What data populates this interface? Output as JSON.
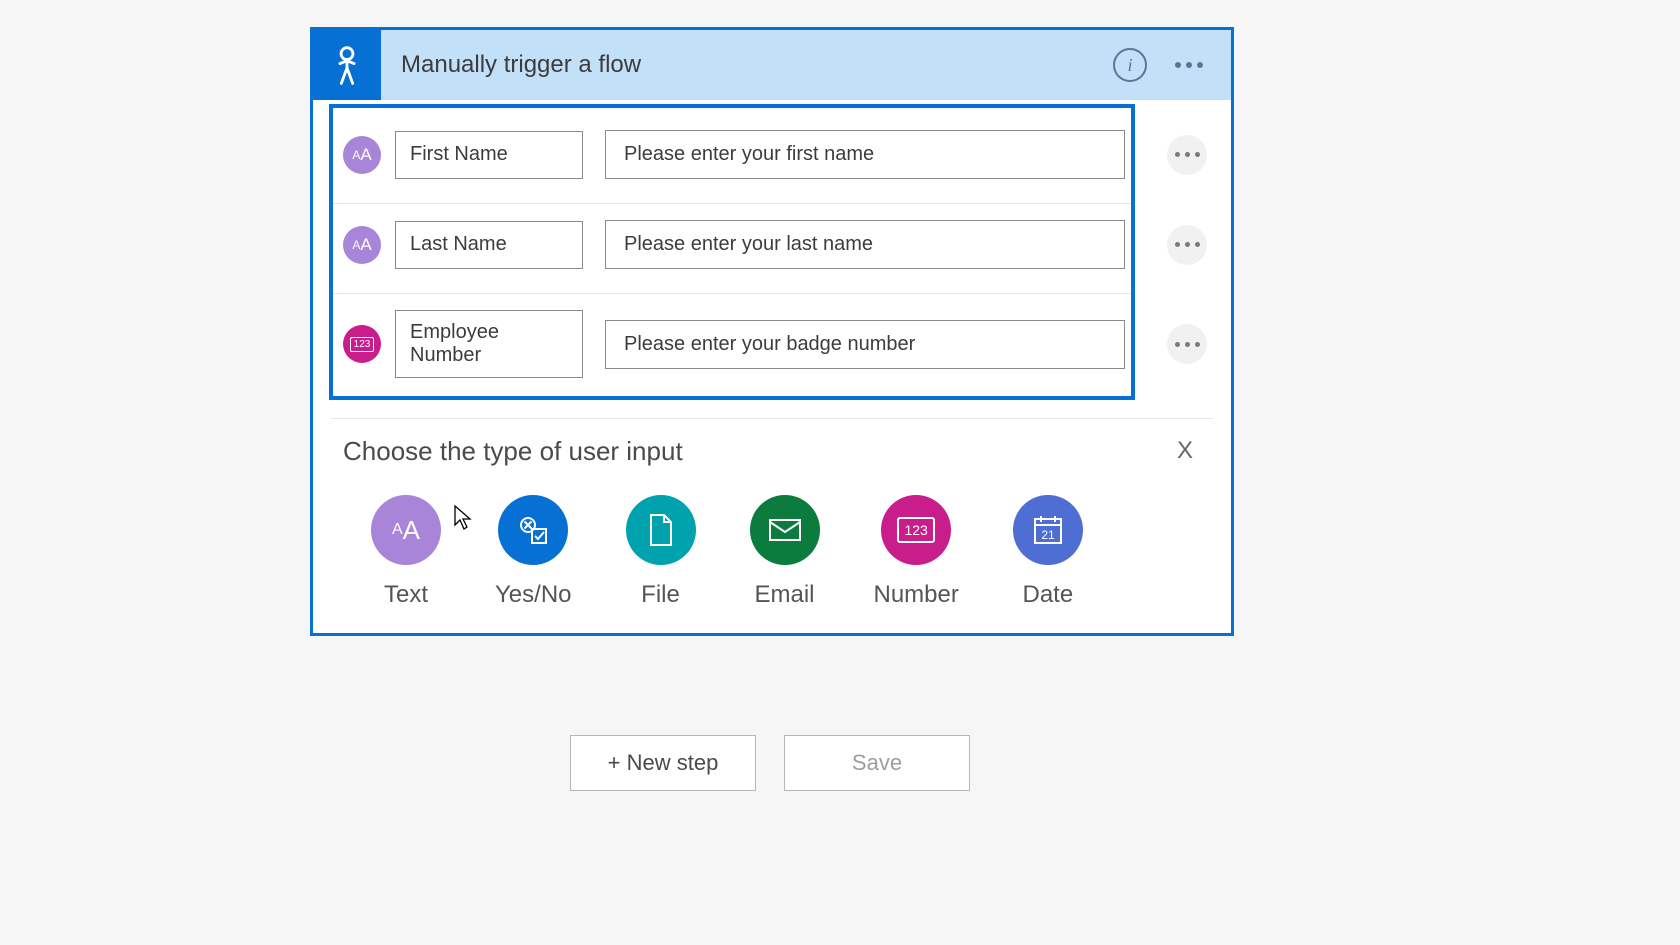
{
  "trigger": {
    "title": "Manually trigger a flow"
  },
  "inputs": [
    {
      "type": "text",
      "name": "First Name",
      "placeholder": "Please enter your first name"
    },
    {
      "type": "text",
      "name": "Last Name",
      "placeholder": "Please enter your last name"
    },
    {
      "type": "number",
      "name": "Employee Number",
      "placeholder": "Please enter your badge number"
    }
  ],
  "chooser": {
    "title": "Choose the type of user input",
    "close": "X",
    "types": [
      {
        "key": "text",
        "label": "Text"
      },
      {
        "key": "yesno",
        "label": "Yes/No"
      },
      {
        "key": "file",
        "label": "File"
      },
      {
        "key": "email",
        "label": "Email"
      },
      {
        "key": "number",
        "label": "Number"
      },
      {
        "key": "date",
        "label": "Date"
      }
    ]
  },
  "footer": {
    "new_step": "+ New step",
    "save": "Save"
  }
}
